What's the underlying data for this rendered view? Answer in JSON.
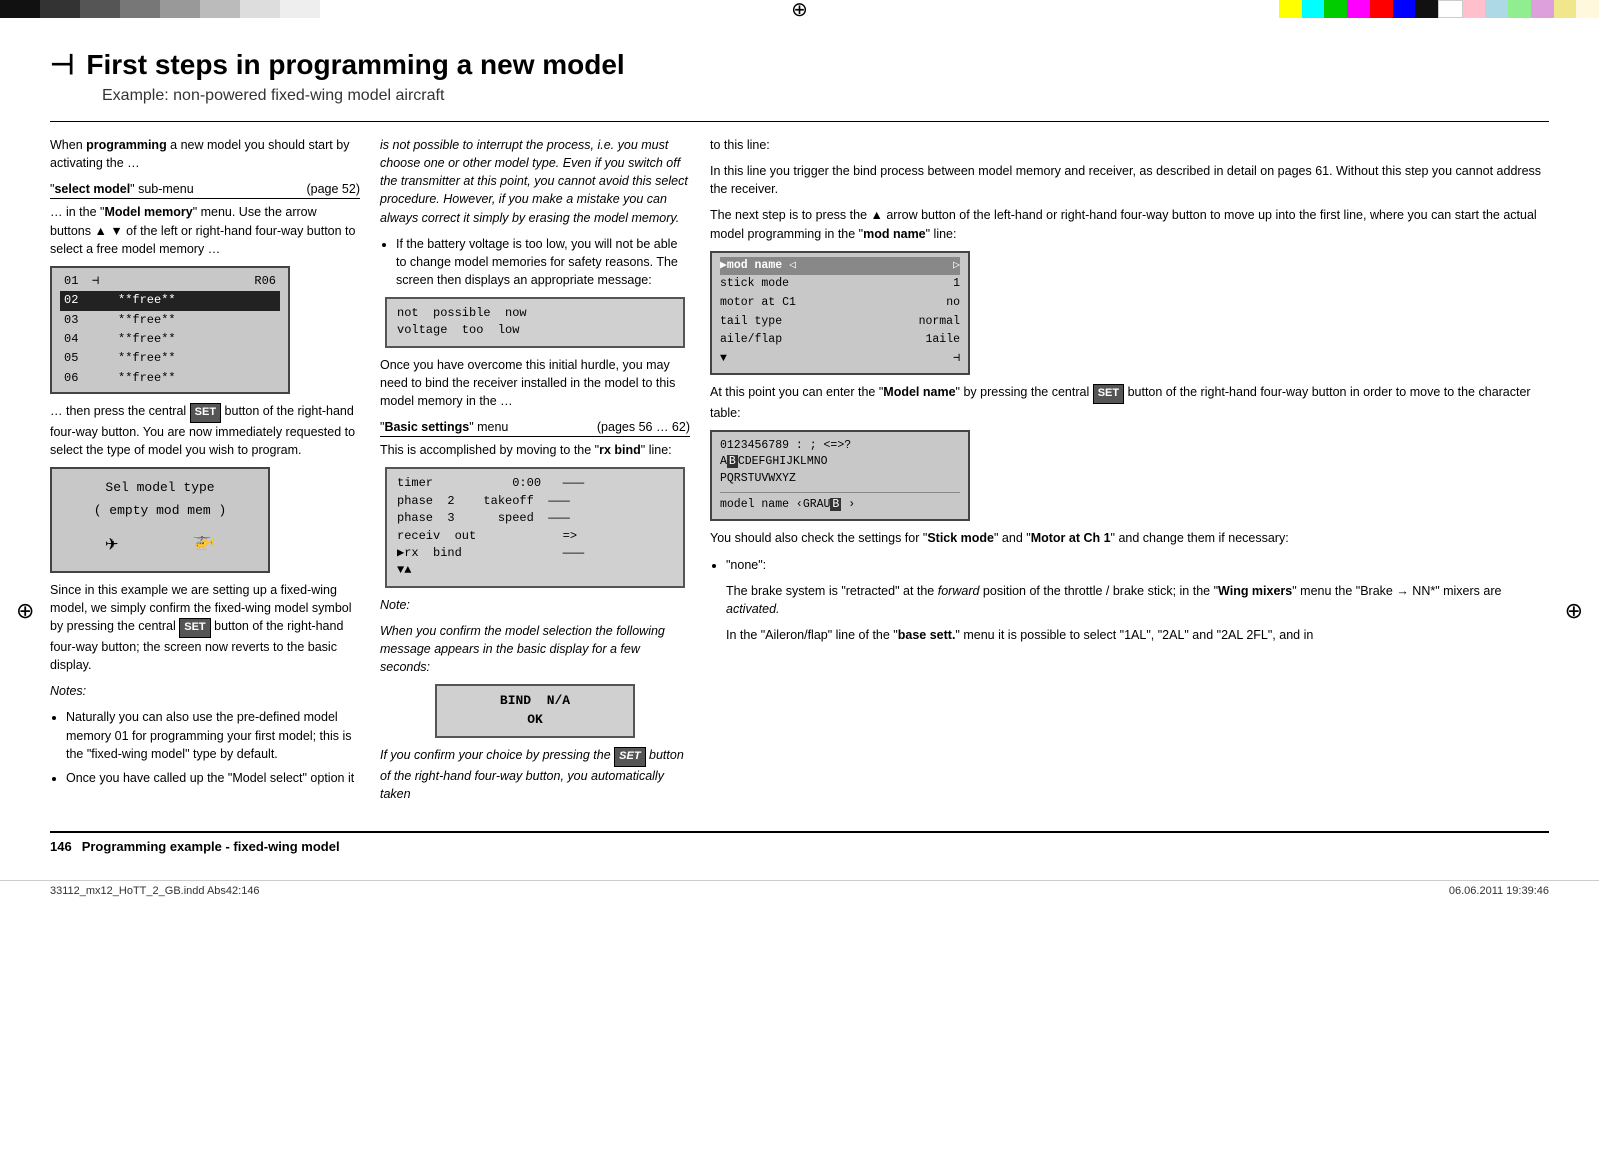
{
  "colorBarsLeft": [
    "#111",
    "#333",
    "#555",
    "#777",
    "#999",
    "#bbb",
    "#ddd",
    "#eee"
  ],
  "colorBarsRight": [
    "#ffff00",
    "#00ffff",
    "#00ff00",
    "#ff00ff",
    "#ff0000",
    "#0000ff",
    "#ff8800",
    "#222",
    "#fff",
    "#ffc0cb",
    "#add8e6",
    "#90ee90",
    "#dda0dd",
    "#f0e68c"
  ],
  "header": {
    "icon": "✦",
    "title": "First steps in programming a new model",
    "subtitle": "Example: non-powered fixed-wing model aircraft"
  },
  "col1": {
    "intro": "When programming a new model you should start by activating the …",
    "sub_menu_label": "\"select model\" sub-menu",
    "sub_menu_page": "(page 52)",
    "model_memory_text": "… in the \"Model memory\" menu. Use the arrow buttons ▲ ▼ of the left or right-hand four-way button to select a free model memory …",
    "screen_rows": [
      {
        "num": "01",
        "sym": "⊣",
        "name": "",
        "ref": "R06",
        "selected": false
      },
      {
        "num": "02",
        "sym": "",
        "name": "**free**",
        "ref": "",
        "selected": true
      },
      {
        "num": "03",
        "sym": "",
        "name": "**free**",
        "ref": "",
        "selected": false
      },
      {
        "num": "04",
        "sym": "",
        "name": "**free**",
        "ref": "",
        "selected": false
      },
      {
        "num": "05",
        "sym": "",
        "name": "**free**",
        "ref": "",
        "selected": false
      },
      {
        "num": "06",
        "sym": "",
        "name": "**free**",
        "ref": "",
        "selected": false
      }
    ],
    "press_set_text": "… then press the central",
    "set_badge": "SET",
    "press_set_text2": "button of the right-hand four-way button. You are now immediately requested to select the type of model you wish to program.",
    "sel_model_line1": "Sel  model  type",
    "sel_model_line2": "( empty  mod  mem )",
    "fixed_wing_text": "Since in this example we are setting up a fixed-wing model, we simply confirm the fixed-wing model symbol by pressing the central",
    "fixed_wing_set": "SET",
    "fixed_wing_text2": "button of the right-hand four-way button; the screen now reverts to the basic display.",
    "notes_heading": "Notes:",
    "notes": [
      "Naturally you can also use the pre-defined model memory 01 for programming your first model; this is the \"fixed-wing model\" type by default.",
      "Once you have called up the \"Model select\" option it"
    ]
  },
  "col2": {
    "continued_text": "is not possible to interrupt the process, i.e. you must choose one or other model type. Even if you switch off the transmitter at this point, you cannot avoid this select procedure. However, if you make a mistake you can always correct it simply by erasing the model memory.",
    "bullet1": "If the battery voltage is too low, you will not be able to change model memories for safety reasons. The screen then displays an appropriate message:",
    "voltage_line1": "not  possible  now",
    "voltage_line2": "voltage  too  low",
    "overcome_text": "Once you have overcome this initial hurdle, you may need to bind the receiver installed in the model to this model memory in the …",
    "basic_settings_label": "\"Basic settings\" menu",
    "basic_settings_page": "(pages 56 … 62)",
    "rx_bind_text": "This is accomplished by moving to the \"rx bind\" line:",
    "rx_screen": {
      "line1": "timer            0:00   ———",
      "line2": "phase  2    takeoff  ———",
      "line3": "phase  3      speed  ———",
      "line4": "receiv  out            =>",
      "line5": "▶rx  bind              ———",
      "line6": "▼▲"
    },
    "note_heading": "Note:",
    "note_text": "When you confirm the model selection the following message appears in the basic display for a few seconds:",
    "bind_line1": "BIND  N/A",
    "bind_line2": "OK",
    "confirm_text": "If you confirm your choice by pressing the",
    "confirm_set": "SET",
    "confirm_text2": "button of the right-hand four-way button, you automatically taken"
  },
  "col3": {
    "to_this_line": "to this line:",
    "bind_process_text": "In this line you trigger the bind process between model memory and receiver, as described in detail on pages 61. Without this step you cannot address the receiver.",
    "next_step_text": "The next step is to press the ▲ arrow button of the left-hand or right-hand four-way button to move up into the first line, where you can start the actual model programming in the \"mod name\" line:",
    "mod_name_screen": {
      "line1": "▶mod  name  ◁         ▷",
      "line2": "stick  mode           1",
      "line3": "motor  at  C1        no",
      "line4": "tail  type       normal",
      "line5": "aile/flap         1aile",
      "line6": "▼                    ⊣"
    },
    "model_name_text": "At this point you can enter the \"Model name\" by pressing the central",
    "model_name_set": "SET",
    "model_name_text2": "button of the right-hand four-way button in order to move to the character table:",
    "char_table": {
      "line1": "0123456789 : ; <=)?",
      "line2": "A▣CDEFGHIJKLMNO",
      "line3": "PQRSTUVWXYZ",
      "line4": "——————————",
      "line5": "model  name  ‹GRAU▣     ›"
    },
    "stick_mode_text": "You should also check the settings for \"Stick mode\" and \"Motor at Ch 1\" and change them if necessary:",
    "none_bullet": "\"none\":",
    "brake_text": "The brake system is \"retracted\" at the forward position of the throttle / brake stick; in the \"Wing mixers\" menu the \"Brake → NN*\" mixers are activated.",
    "aileron_text": "In the \"Aileron/flap\" line of the \"base sett.\" menu it is possible to select \"1AL\", \"2AL\" and \"2AL  2FL\", and in"
  },
  "footer": {
    "page_num": "146",
    "text": "Programming example - fixed-wing model"
  },
  "bottom_bar": {
    "left": "33112_mx12_HoTT_2_GB.indd   Abs42:146",
    "right": "06.06.2011   19:39:46"
  }
}
